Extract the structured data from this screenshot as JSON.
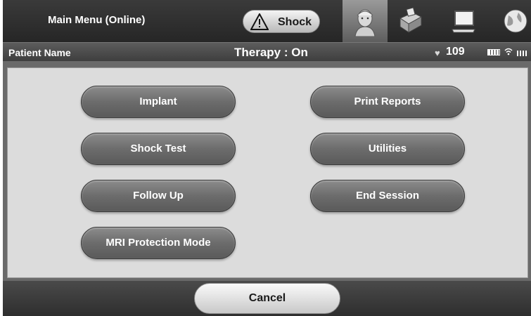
{
  "header": {
    "menu_title": "Main Menu (Online)",
    "shock_label": "Shock",
    "icons": [
      "nurse-avatar-icon",
      "programmer-device-icon",
      "laptop-icon",
      "globe-icon"
    ]
  },
  "status": {
    "patient_name": "Patient Name",
    "therapy": "Therapy : On",
    "heart_rate": "109"
  },
  "menu": {
    "implant": "Implant",
    "shock_test": "Shock Test",
    "follow_up": "Follow Up",
    "mri_mode": "MRI Protection Mode",
    "print_reports": "Print Reports",
    "utilities": "Utilities",
    "end_session": "End Session"
  },
  "footer": {
    "cancel": "Cancel"
  },
  "colors": {
    "button_gray": "#6c6c6c",
    "panel": "#dcdcdc",
    "topbar": "#2e2e2e"
  }
}
